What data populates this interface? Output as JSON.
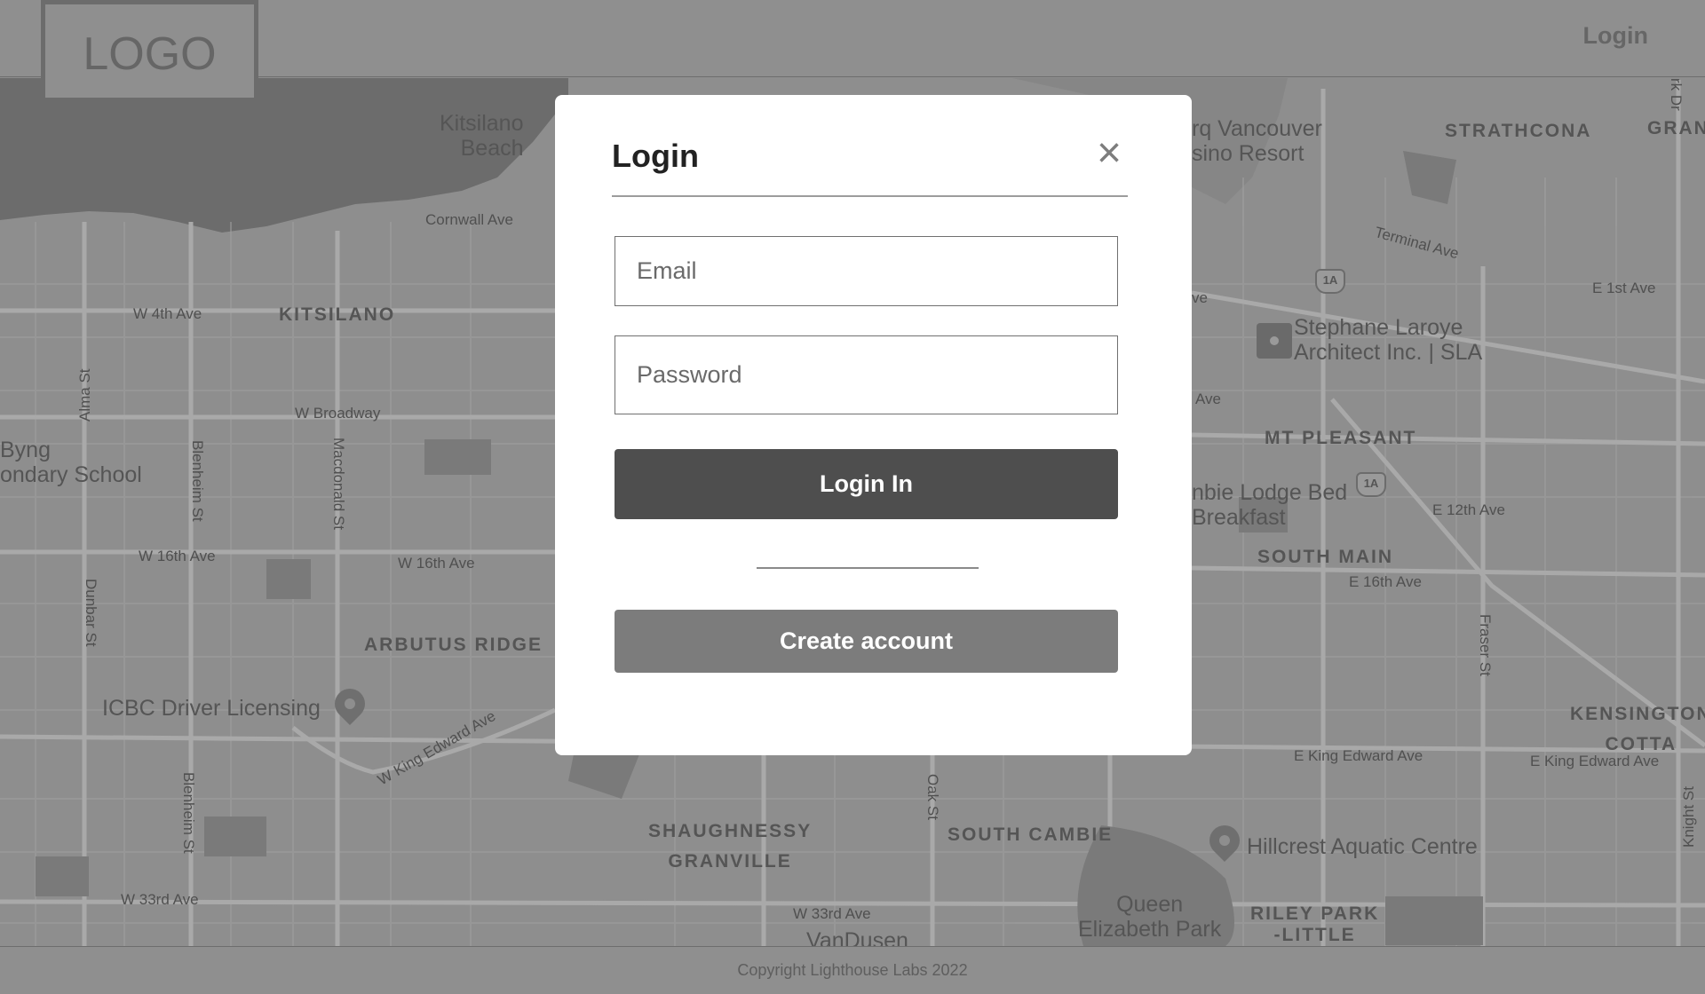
{
  "header": {
    "logo": "LOGO",
    "nav_login": "Login"
  },
  "modal": {
    "title": "Login",
    "close_icon": "×",
    "email_placeholder": "Email",
    "password_placeholder": "Password",
    "login_button": "Login In",
    "create_account_button": "Create account"
  },
  "footer": {
    "copyright": "Copyright Lighthouse Labs 2022"
  },
  "map": {
    "streets": {
      "cornwall_ave": "Cornwall Ave",
      "w_4th_ave": "W 4th Ave",
      "w_broadway": "W Broadway",
      "w_16th_ave_1": "W 16th Ave",
      "w_16th_ave_2": "W 16th Ave",
      "w_king_edward_ave": "W King Edward Ave",
      "w_33rd_ave_1": "W 33rd Ave",
      "w_33rd_ave_2": "W 33rd Ave",
      "alma_st": "Alma St",
      "blenheim_st_1": "Blenheim St",
      "blenheim_st_2": "Blenheim St",
      "macdonald_st": "Macdonald St",
      "dunbar_st": "Dunbar St",
      "oak_st": "Oak St",
      "terminal_ave": "Terminal Ave",
      "e_1st_ave": "E 1st Ave",
      "e_12th_ave": "E 12th Ave",
      "e_16th_ave": "E 16th Ave",
      "fraser_st": "Fraser St",
      "e_king_edward_ave_1": "E King Edward Ave",
      "e_king_edward_ave_2": "E King Edward Ave",
      "knight_st": "Knight St",
      "ave_fragment_1": "ve",
      "ave_fragment_2": "Ave",
      "dr_fragment": "rk Dr"
    },
    "neighborhoods": {
      "kitsilano": "KITSILANO",
      "arbutus_ridge": "ARBUTUS RIDGE",
      "shaughnessy": "SHAUGHNESSY\nGRANVILLE",
      "south_cambie": "SOUTH CAMBIE",
      "strathcona": "STRATHCONA",
      "grandview": "GRAN",
      "mt_pleasant": "MT PLEASANT",
      "south_main": "SOUTH MAIN",
      "kensington": "KENSINGTON\nCOTTA",
      "riley_park": "RILEY PARK\n-LITTLE"
    },
    "pois": {
      "kitsilano_beach": "Kitsilano\nBeach",
      "byng_school": "Byng\nondary School",
      "icbc": "ICBC Driver Licensing",
      "casino": "rq Vancouver\nsino Resort",
      "stephane": "Stephane Laroye\nArchitect Inc. | SLA",
      "lodge": "nbie Lodge Bed\nBreakfast",
      "hillcrest": "Hillcrest Aquatic Centre",
      "queen_elizabeth": "Queen\nElizabeth Park",
      "vandusen": "VanDusen"
    },
    "highway_shields": [
      "1A",
      "1A"
    ]
  }
}
